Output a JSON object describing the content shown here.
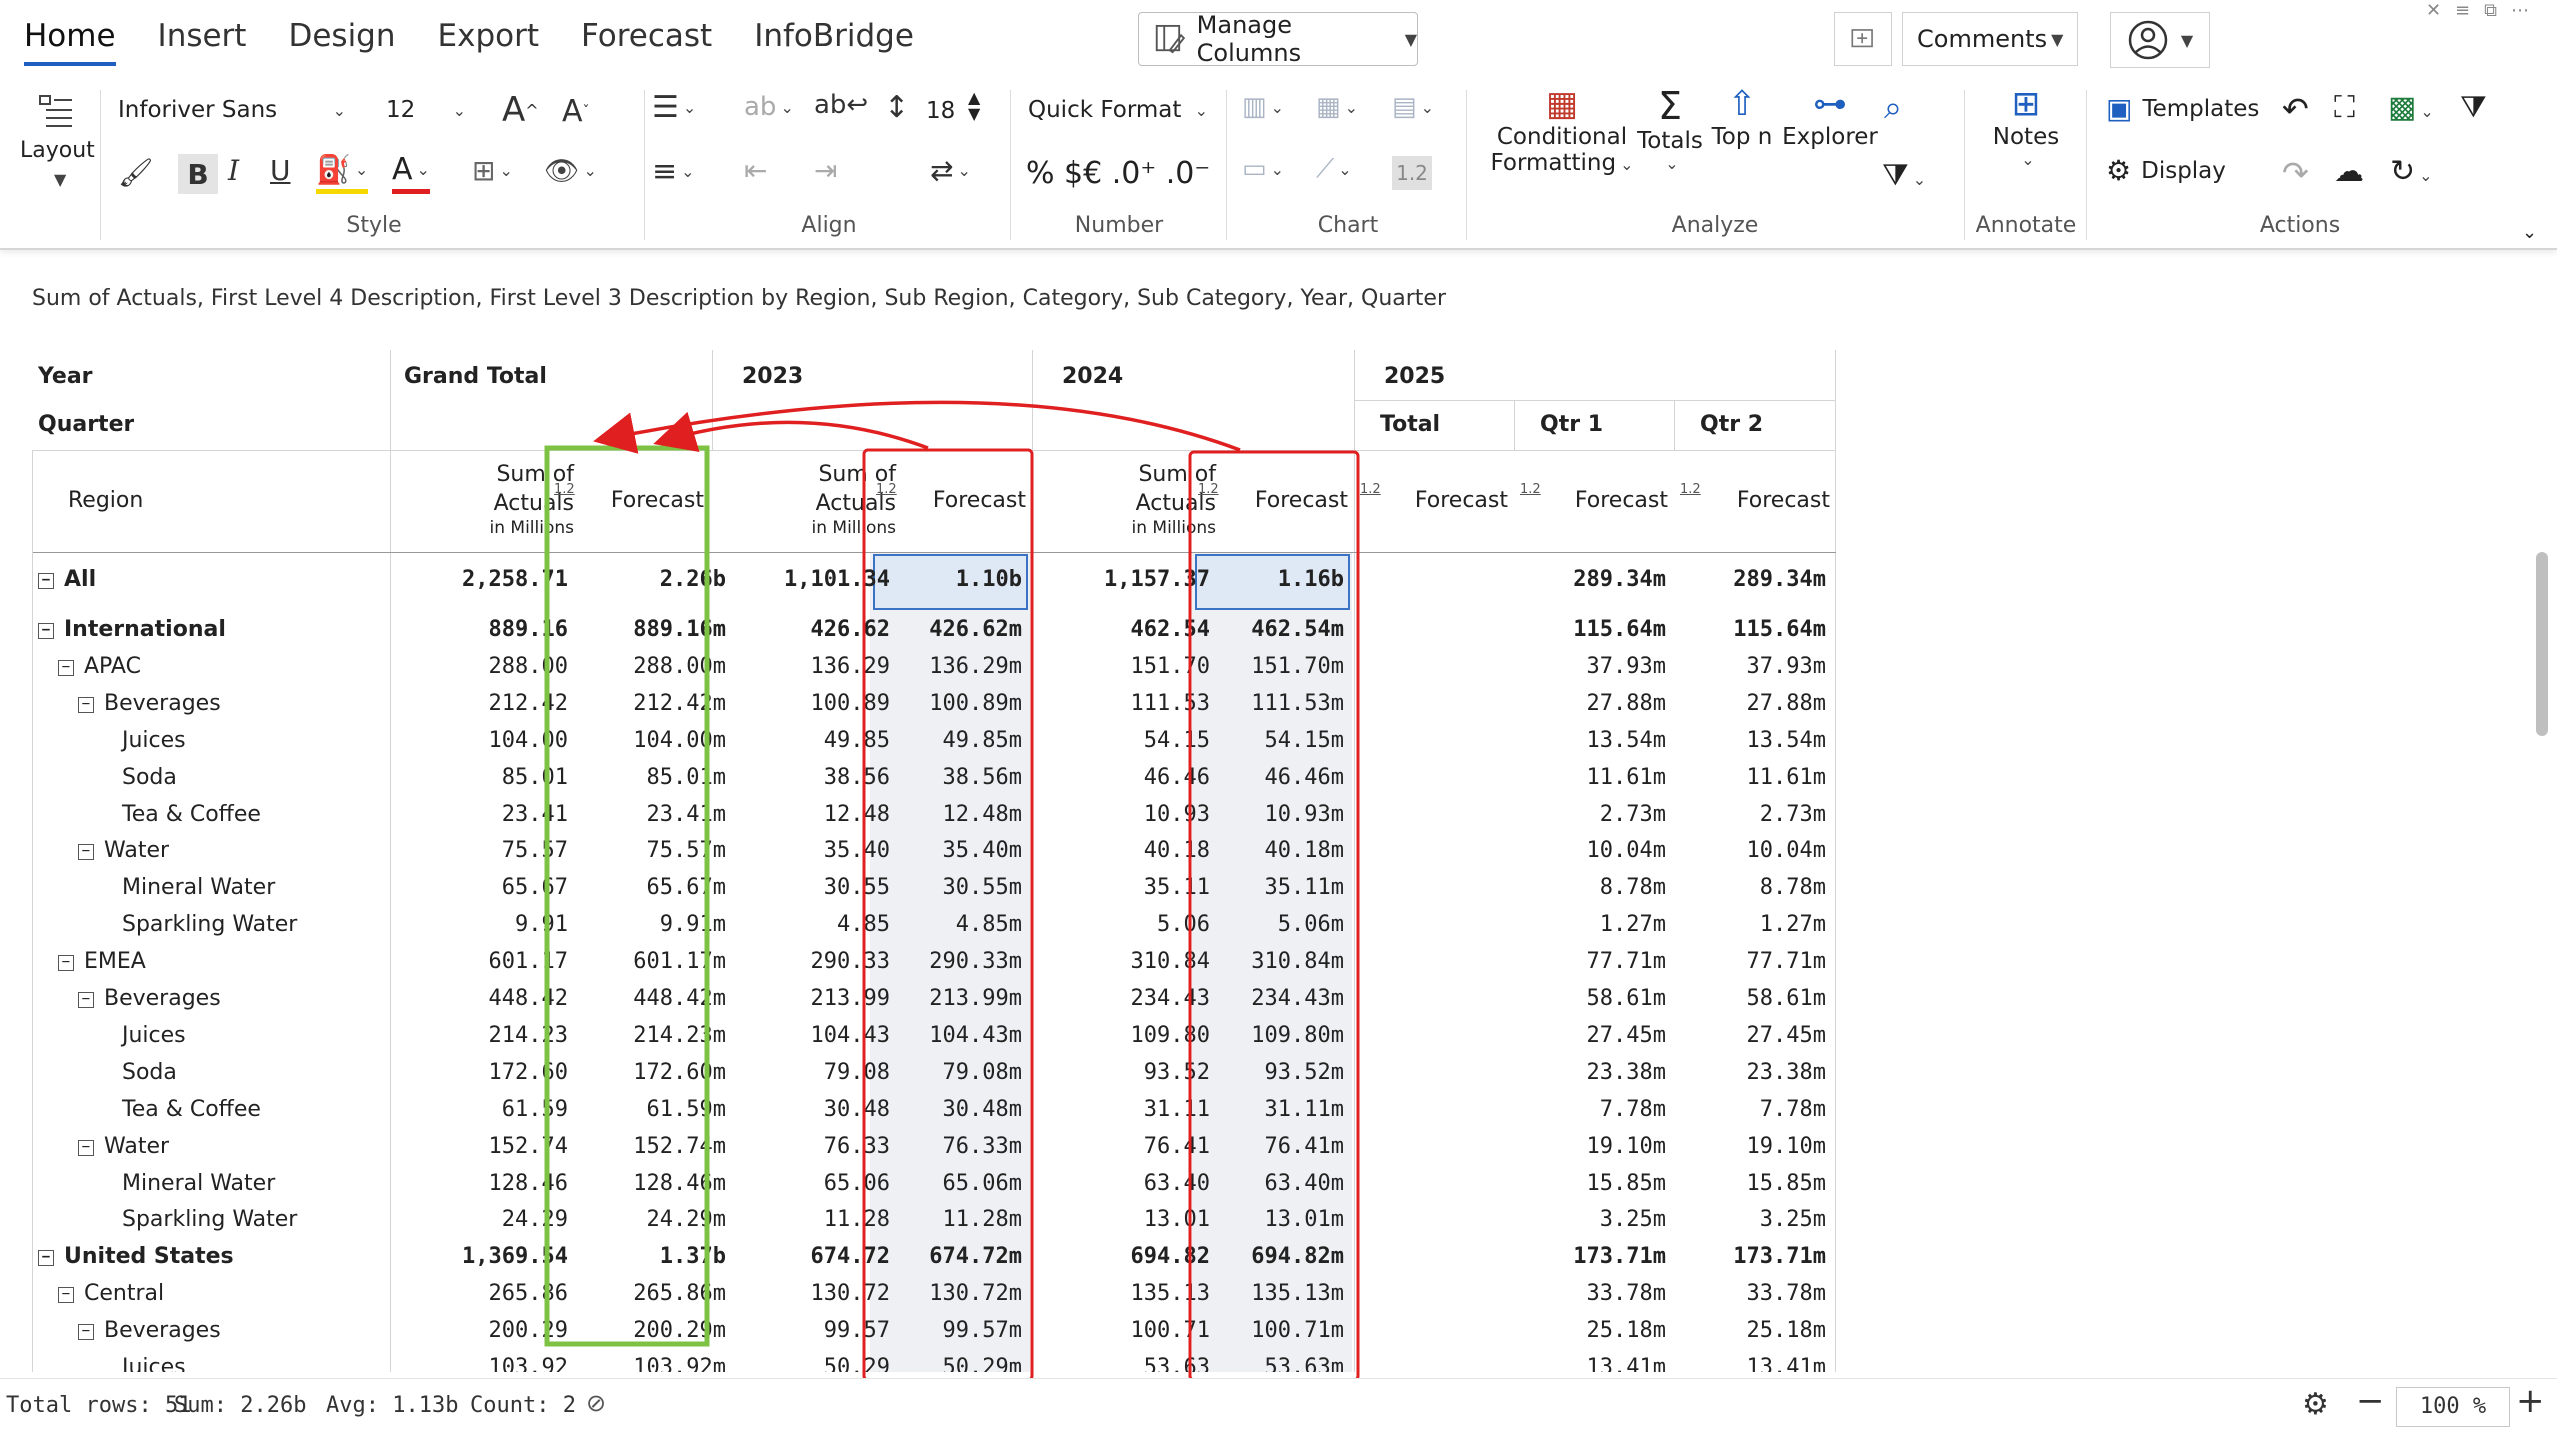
{
  "tabs": [
    "Home",
    "Insert",
    "Design",
    "Export",
    "Forecast",
    "InfoBridge"
  ],
  "manage_columns": "Manage Columns",
  "comments": "Comments",
  "ribbon": {
    "layout_label": "Layout",
    "font_name": "Inforiver Sans",
    "font_size": "12",
    "line_height": "18",
    "quick_format": "Quick Format",
    "number_symbols": "% $€ .0⁺ .0⁻",
    "chart_value": "1.2",
    "conditional": "Conditional",
    "formatting": "Formatting",
    "totals": "Totals",
    "topn": "Top n",
    "explorer": "Explorer",
    "notes": "Notes",
    "templates": "Templates",
    "display": "Display",
    "groups": {
      "style": "Style",
      "align": "Align",
      "number": "Number",
      "chart": "Chart",
      "analyze": "Analyze",
      "annotate": "Annotate",
      "actions": "Actions"
    }
  },
  "subtitle": "Sum of Actuals, First Level 4 Description, First Level 3 Description by Region, Sub Region, Category, Sub Category, Year, Quarter",
  "grid": {
    "hdr_year": "Year",
    "hdr_quarter": "Quarter",
    "hdr_region": "Region",
    "years": [
      "Grand Total",
      "2023",
      "2024",
      "2025"
    ],
    "quarters_2025": [
      "Total",
      "Qtr 1",
      "Qtr 2"
    ],
    "sum_top": "Sum of",
    "sum_mid": "Actuals",
    "sum_unit": "in Millions",
    "forecast": "Forecast",
    "tag12": "1.2",
    "rows": [
      {
        "label": "All",
        "level": 0,
        "bold": true,
        "toggle": true,
        "v": [
          "2,258.71",
          "2.26b",
          "1,101.34",
          "1.10b",
          "1,157.37",
          "1.16b",
          "",
          "289.34m",
          "289.34m"
        ]
      },
      {
        "label": "International",
        "level": 0,
        "bold": true,
        "toggle": true,
        "v": [
          "889.16",
          "889.16m",
          "426.62",
          "426.62m",
          "462.54",
          "462.54m",
          "",
          "115.64m",
          "115.64m"
        ]
      },
      {
        "label": "APAC",
        "level": 1,
        "bold": false,
        "toggle": true,
        "v": [
          "288.00",
          "288.00m",
          "136.29",
          "136.29m",
          "151.70",
          "151.70m",
          "",
          "37.93m",
          "37.93m"
        ]
      },
      {
        "label": "Beverages",
        "level": 2,
        "bold": false,
        "toggle": true,
        "v": [
          "212.42",
          "212.42m",
          "100.89",
          "100.89m",
          "111.53",
          "111.53m",
          "",
          "27.88m",
          "27.88m"
        ]
      },
      {
        "label": "Juices",
        "level": 3,
        "bold": false,
        "toggle": false,
        "v": [
          "104.00",
          "104.00m",
          "49.85",
          "49.85m",
          "54.15",
          "54.15m",
          "",
          "13.54m",
          "13.54m"
        ]
      },
      {
        "label": "Soda",
        "level": 3,
        "bold": false,
        "toggle": false,
        "v": [
          "85.01",
          "85.01m",
          "38.56",
          "38.56m",
          "46.46",
          "46.46m",
          "",
          "11.61m",
          "11.61m"
        ]
      },
      {
        "label": "Tea & Coffee",
        "level": 3,
        "bold": false,
        "toggle": false,
        "v": [
          "23.41",
          "23.41m",
          "12.48",
          "12.48m",
          "10.93",
          "10.93m",
          "",
          "2.73m",
          "2.73m"
        ]
      },
      {
        "label": "Water",
        "level": 2,
        "bold": false,
        "toggle": true,
        "v": [
          "75.57",
          "75.57m",
          "35.40",
          "35.40m",
          "40.18",
          "40.18m",
          "",
          "10.04m",
          "10.04m"
        ]
      },
      {
        "label": "Mineral Water",
        "level": 3,
        "bold": false,
        "toggle": false,
        "v": [
          "65.67",
          "65.67m",
          "30.55",
          "30.55m",
          "35.11",
          "35.11m",
          "",
          "8.78m",
          "8.78m"
        ]
      },
      {
        "label": "Sparkling Water",
        "level": 3,
        "bold": false,
        "toggle": false,
        "v": [
          "9.91",
          "9.91m",
          "4.85",
          "4.85m",
          "5.06",
          "5.06m",
          "",
          "1.27m",
          "1.27m"
        ]
      },
      {
        "label": "EMEA",
        "level": 1,
        "bold": false,
        "toggle": true,
        "v": [
          "601.17",
          "601.17m",
          "290.33",
          "290.33m",
          "310.84",
          "310.84m",
          "",
          "77.71m",
          "77.71m"
        ]
      },
      {
        "label": "Beverages",
        "level": 2,
        "bold": false,
        "toggle": true,
        "v": [
          "448.42",
          "448.42m",
          "213.99",
          "213.99m",
          "234.43",
          "234.43m",
          "",
          "58.61m",
          "58.61m"
        ]
      },
      {
        "label": "Juices",
        "level": 3,
        "bold": false,
        "toggle": false,
        "v": [
          "214.23",
          "214.23m",
          "104.43",
          "104.43m",
          "109.80",
          "109.80m",
          "",
          "27.45m",
          "27.45m"
        ]
      },
      {
        "label": "Soda",
        "level": 3,
        "bold": false,
        "toggle": false,
        "v": [
          "172.60",
          "172.60m",
          "79.08",
          "79.08m",
          "93.52",
          "93.52m",
          "",
          "23.38m",
          "23.38m"
        ]
      },
      {
        "label": "Tea & Coffee",
        "level": 3,
        "bold": false,
        "toggle": false,
        "v": [
          "61.59",
          "61.59m",
          "30.48",
          "30.48m",
          "31.11",
          "31.11m",
          "",
          "7.78m",
          "7.78m"
        ]
      },
      {
        "label": "Water",
        "level": 2,
        "bold": false,
        "toggle": true,
        "v": [
          "152.74",
          "152.74m",
          "76.33",
          "76.33m",
          "76.41",
          "76.41m",
          "",
          "19.10m",
          "19.10m"
        ]
      },
      {
        "label": "Mineral Water",
        "level": 3,
        "bold": false,
        "toggle": false,
        "v": [
          "128.46",
          "128.46m",
          "65.06",
          "65.06m",
          "63.40",
          "63.40m",
          "",
          "15.85m",
          "15.85m"
        ]
      },
      {
        "label": "Sparkling Water",
        "level": 3,
        "bold": false,
        "toggle": false,
        "v": [
          "24.29",
          "24.29m",
          "11.28",
          "11.28m",
          "13.01",
          "13.01m",
          "",
          "3.25m",
          "3.25m"
        ]
      },
      {
        "label": "United States",
        "level": 0,
        "bold": true,
        "toggle": true,
        "v": [
          "1,369.54",
          "1.37b",
          "674.72",
          "674.72m",
          "694.82",
          "694.82m",
          "",
          "173.71m",
          "173.71m"
        ]
      },
      {
        "label": "Central",
        "level": 1,
        "bold": false,
        "toggle": true,
        "v": [
          "265.86",
          "265.86m",
          "130.72",
          "130.72m",
          "135.13",
          "135.13m",
          "",
          "33.78m",
          "33.78m"
        ]
      },
      {
        "label": "Beverages",
        "level": 2,
        "bold": false,
        "toggle": true,
        "v": [
          "200.29",
          "200.29m",
          "99.57",
          "99.57m",
          "100.71",
          "100.71m",
          "",
          "25.18m",
          "25.18m"
        ]
      },
      {
        "label": "Juices",
        "level": 3,
        "bold": false,
        "toggle": false,
        "v": [
          "103.92",
          "103.92m",
          "50.29",
          "50.29m",
          "53.63",
          "53.63m",
          "",
          "13.41m",
          "13.41m"
        ]
      }
    ]
  },
  "status": {
    "total_rows": "Total rows: 51",
    "sum": "Sum: 2.26b",
    "avg": "Avg: 1.13b",
    "count": "Count: 2",
    "zoom": "100 %"
  },
  "colors": {
    "accent": "#1f5fbf",
    "highlight_red": "#e02020",
    "highlight_green": "#7dc242",
    "selected_fill": "#dfe8f5"
  }
}
